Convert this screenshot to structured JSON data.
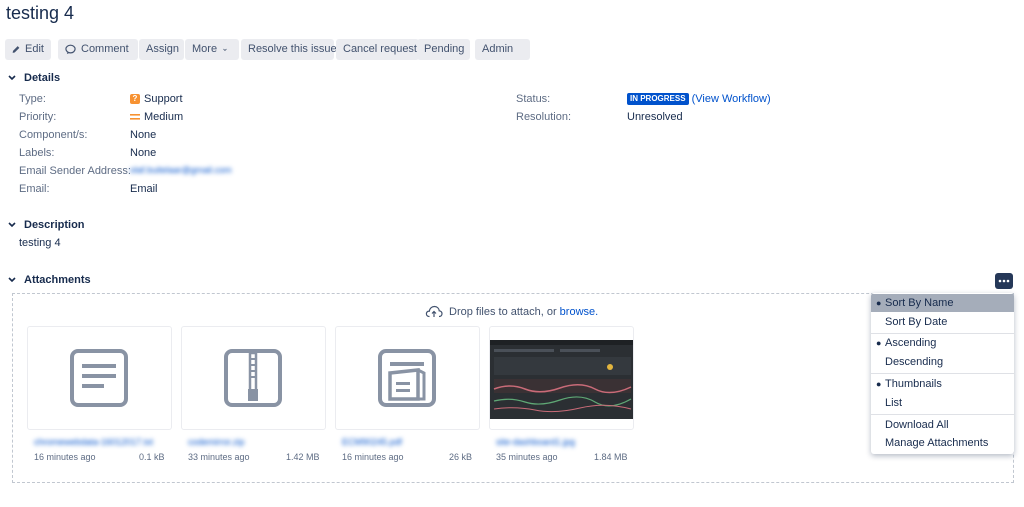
{
  "issue": {
    "title": "testing 4"
  },
  "toolbar": {
    "edit": "Edit",
    "comment": "Comment",
    "assign": "Assign",
    "more": "More",
    "resolve": "Resolve this issue",
    "cancel": "Cancel request",
    "pending": "Pending",
    "admin": "Admin"
  },
  "details": {
    "heading": "Details",
    "fields": [
      {
        "label": "Type:",
        "value": "Support",
        "icon": "support-type-icon"
      },
      {
        "label": "Priority:",
        "value": "Medium",
        "icon": "medium-priority-icon"
      },
      {
        "label": "Component/s:",
        "value": "None"
      },
      {
        "label": "Labels:",
        "value": "None"
      },
      {
        "label": "Email Sender Address:",
        "value": "olaf.buitelaar@gmail.com"
      },
      {
        "label": "Email:",
        "value": "Email"
      }
    ],
    "status_label": "Status:",
    "status_value": "IN PROGRESS",
    "workflow_link": "(View Workflow)",
    "resolution_label": "Resolution:",
    "resolution_value": "Unresolved"
  },
  "description": {
    "heading": "Description",
    "text": "testing 4"
  },
  "attachments": {
    "heading": "Attachments",
    "drop_text": "Drop files to attach, or",
    "browse": "browse.",
    "items": [
      {
        "name": "chromewebdata-16012017.txt",
        "age": "16 minutes ago",
        "size": "0.1 kB",
        "icon": "text-file-icon"
      },
      {
        "name": "codemirror.zip",
        "age": "33 minutes ago",
        "size": "1.42 MB",
        "icon": "zip-file-icon"
      },
      {
        "name": "ECM90245.pdf",
        "age": "16 minutes ago",
        "size": "26 kB",
        "icon": "pdf-file-icon"
      },
      {
        "name": "site-dashboard1.jpg",
        "age": "35 minutes ago",
        "size": "1.84 MB",
        "icon": "image-thumbnail"
      }
    ]
  },
  "menu": {
    "sort_by_name": "Sort By Name",
    "sort_by_date": "Sort By Date",
    "ascending": "Ascending",
    "descending": "Descending",
    "thumbnails": "Thumbnails",
    "list": "List",
    "download_all": "Download All",
    "manage": "Manage Attachments"
  },
  "colors": {
    "link": "#0052cc",
    "lozenge": "#0052cc",
    "button_bg": "#ebecf0",
    "menu_selected": "#a5adba"
  }
}
